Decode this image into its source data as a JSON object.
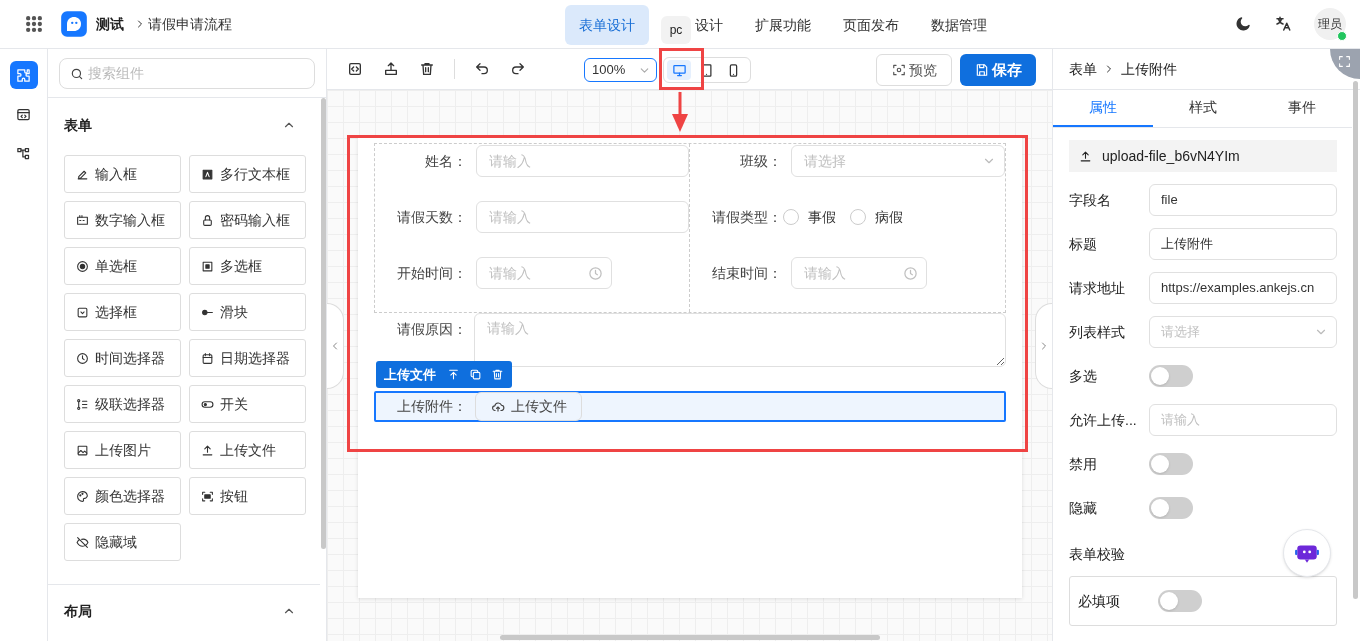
{
  "header": {
    "app_name": "测试",
    "breadcrumb": "请假申请流程",
    "nav": [
      {
        "label": "表单设计",
        "selected": true
      },
      {
        "label": "设计",
        "selected": false,
        "tooltip": "pc"
      },
      {
        "label": "扩展功能",
        "selected": false
      },
      {
        "label": "页面发布",
        "selected": false
      },
      {
        "label": "数据管理",
        "selected": false
      }
    ],
    "avatar": "理员"
  },
  "left_rail": {
    "items": [
      {
        "selected": true
      },
      {
        "selected": false
      },
      {
        "selected": false
      }
    ]
  },
  "components_panel": {
    "search": {
      "placeholder": "搜索组件"
    },
    "sections": [
      {
        "title": "表单",
        "expanded": true,
        "items": [
          "输入框",
          "多行文本框",
          "数字输入框",
          "密码输入框",
          "单选框",
          "多选框",
          "选择框",
          "滑块",
          "时间选择器",
          "日期选择器",
          "级联选择器",
          "开关",
          "上传图片",
          "上传文件",
          "颜色选择器",
          "按钮",
          "隐藏域"
        ]
      },
      {
        "title": "布局",
        "expanded": true
      }
    ]
  },
  "toolbar": {
    "zoom": "100%",
    "devices": [
      {
        "selected": true
      },
      {
        "selected": false
      },
      {
        "selected": false
      }
    ],
    "preview": "预览",
    "save": "保存"
  },
  "form": {
    "grid_columns": [
      [
        {
          "label": "姓名：",
          "kind": "input",
          "placeholder": "请输入"
        },
        {
          "label": "请假天数：",
          "kind": "input",
          "placeholder": "请输入"
        },
        {
          "label": "开始时间：",
          "kind": "time",
          "placeholder": "请输入"
        }
      ],
      [
        {
          "label": "班级：",
          "kind": "select",
          "placeholder": "请选择"
        },
        {
          "label": "请假类型：",
          "kind": "radio",
          "options": [
            {
              "label": "事假",
              "selected": false
            },
            {
              "label": "病假",
              "selected": false
            }
          ]
        },
        {
          "label": "结束时间：",
          "kind": "time",
          "placeholder": "请输入"
        }
      ]
    ],
    "fields": [
      {
        "label": "请假原因：",
        "kind": "textarea",
        "placeholder": "请输入",
        "selected": false
      },
      {
        "label": "上传附件：",
        "kind": "upload",
        "button": "上传文件",
        "selected": true
      }
    ],
    "selection_toolbar": {
      "label": "上传文件"
    }
  },
  "properties_panel": {
    "breadcrumb": [
      "表单",
      "上传附件"
    ],
    "tabs": [
      {
        "label": "属性",
        "selected": true
      },
      {
        "label": "样式",
        "selected": false
      },
      {
        "label": "事件",
        "selected": false
      }
    ],
    "component_id": "upload-file_b6vN4YIm",
    "props": [
      {
        "label": "字段名",
        "kind": "input",
        "value": "file"
      },
      {
        "label": "标题",
        "kind": "input",
        "value": "上传附件"
      },
      {
        "label": "请求地址",
        "kind": "input",
        "value": "https://examples.ankejs.cn"
      },
      {
        "label": "列表样式",
        "kind": "select",
        "placeholder": "请选择"
      },
      {
        "label": "多选",
        "kind": "switch",
        "on": false
      },
      {
        "label": "允许上传...",
        "kind": "input",
        "placeholder": "请输入"
      },
      {
        "label": "禁用",
        "kind": "switch",
        "on": false
      },
      {
        "label": "隐藏",
        "kind": "switch",
        "on": false
      }
    ],
    "validation": {
      "title": "表单校验",
      "items": [
        {
          "label": "必填项",
          "on": false
        }
      ]
    }
  }
}
